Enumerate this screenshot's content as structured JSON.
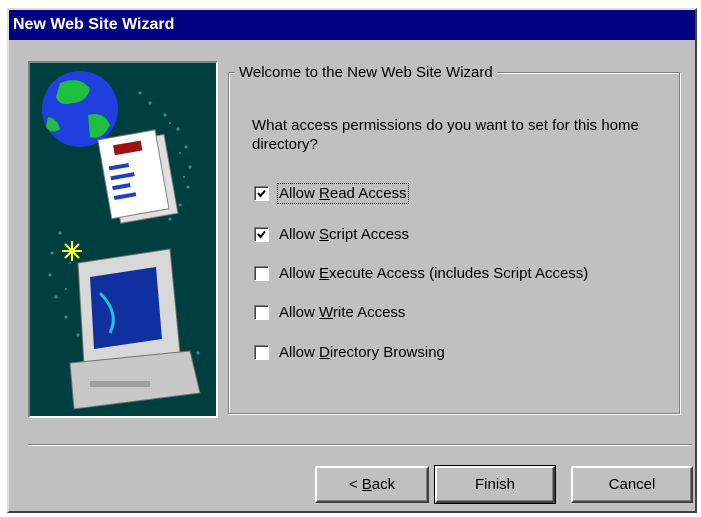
{
  "window": {
    "title": "New Web Site Wizard"
  },
  "group": {
    "legend": "Welcome to the New Web Site Wizard",
    "question": "What access permissions do you want to set for this home directory?"
  },
  "options": [
    {
      "label": "Allow Read Access",
      "mnemonic": "R",
      "checked": true,
      "focused": true
    },
    {
      "label": "Allow Script Access",
      "mnemonic": "S",
      "checked": true,
      "focused": false
    },
    {
      "label": "Allow Execute Access (includes Script Access)",
      "mnemonic": "E",
      "checked": false,
      "focused": false
    },
    {
      "label": "Allow Write Access",
      "mnemonic": "W",
      "checked": false,
      "focused": false
    },
    {
      "label": "Allow Directory Browsing",
      "mnemonic": "D",
      "checked": false,
      "focused": false
    }
  ],
  "buttons": {
    "back": {
      "label": "< Back",
      "mnemonic": "B"
    },
    "finish": {
      "label": "Finish"
    },
    "cancel": {
      "label": "Cancel"
    }
  },
  "illustration": {
    "description_icon": "globe-document-computer-icon"
  },
  "colors": {
    "titlebar": "#000080",
    "face": "#c0c0c0",
    "art_bg": "#003f40"
  }
}
